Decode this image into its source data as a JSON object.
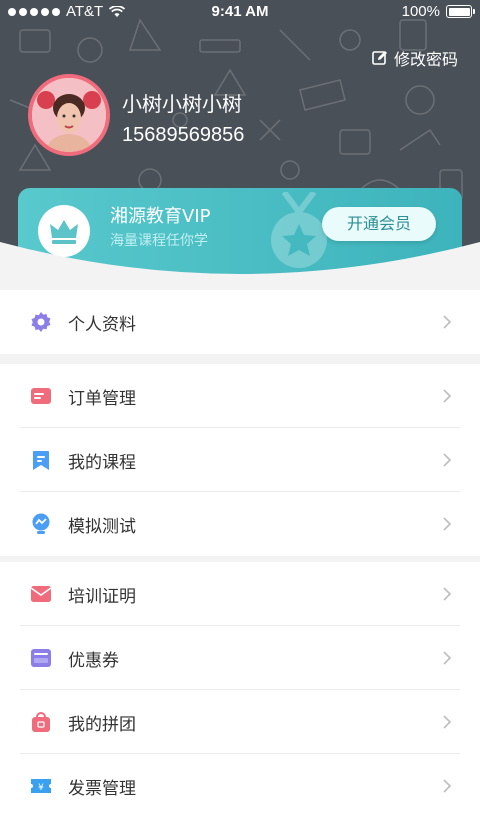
{
  "status": {
    "carrier": "AT&T",
    "time": "9:41 AM",
    "battery": "100%"
  },
  "profile": {
    "edit_password": "修改密码",
    "name": "小树小树小树",
    "phone": "15689569856"
  },
  "vip": {
    "title": "湘源教育VIP",
    "subtitle": "海量课程任你学",
    "button": "开通会员"
  },
  "menu": {
    "group1": [
      {
        "label": "个人资料",
        "icon": "gear-icon"
      }
    ],
    "group2": [
      {
        "label": "订单管理",
        "icon": "order-card-icon"
      },
      {
        "label": "我的课程",
        "icon": "bookmark-icon"
      },
      {
        "label": "模拟测试",
        "icon": "test-bulb-icon"
      }
    ],
    "group3": [
      {
        "label": "培训证明",
        "icon": "envelope-icon"
      },
      {
        "label": "优惠券",
        "icon": "coupon-icon"
      },
      {
        "label": "我的拼团",
        "icon": "shopping-bag-icon"
      },
      {
        "label": "发票管理",
        "icon": "invoice-ticket-icon"
      }
    ]
  },
  "colors": {
    "header_bg": "#4a5058",
    "vip_teal": "#4cbfc5",
    "accent_purple": "#8b7ee8",
    "accent_red": "#f06b7b",
    "accent_blue": "#4a9ef5"
  }
}
